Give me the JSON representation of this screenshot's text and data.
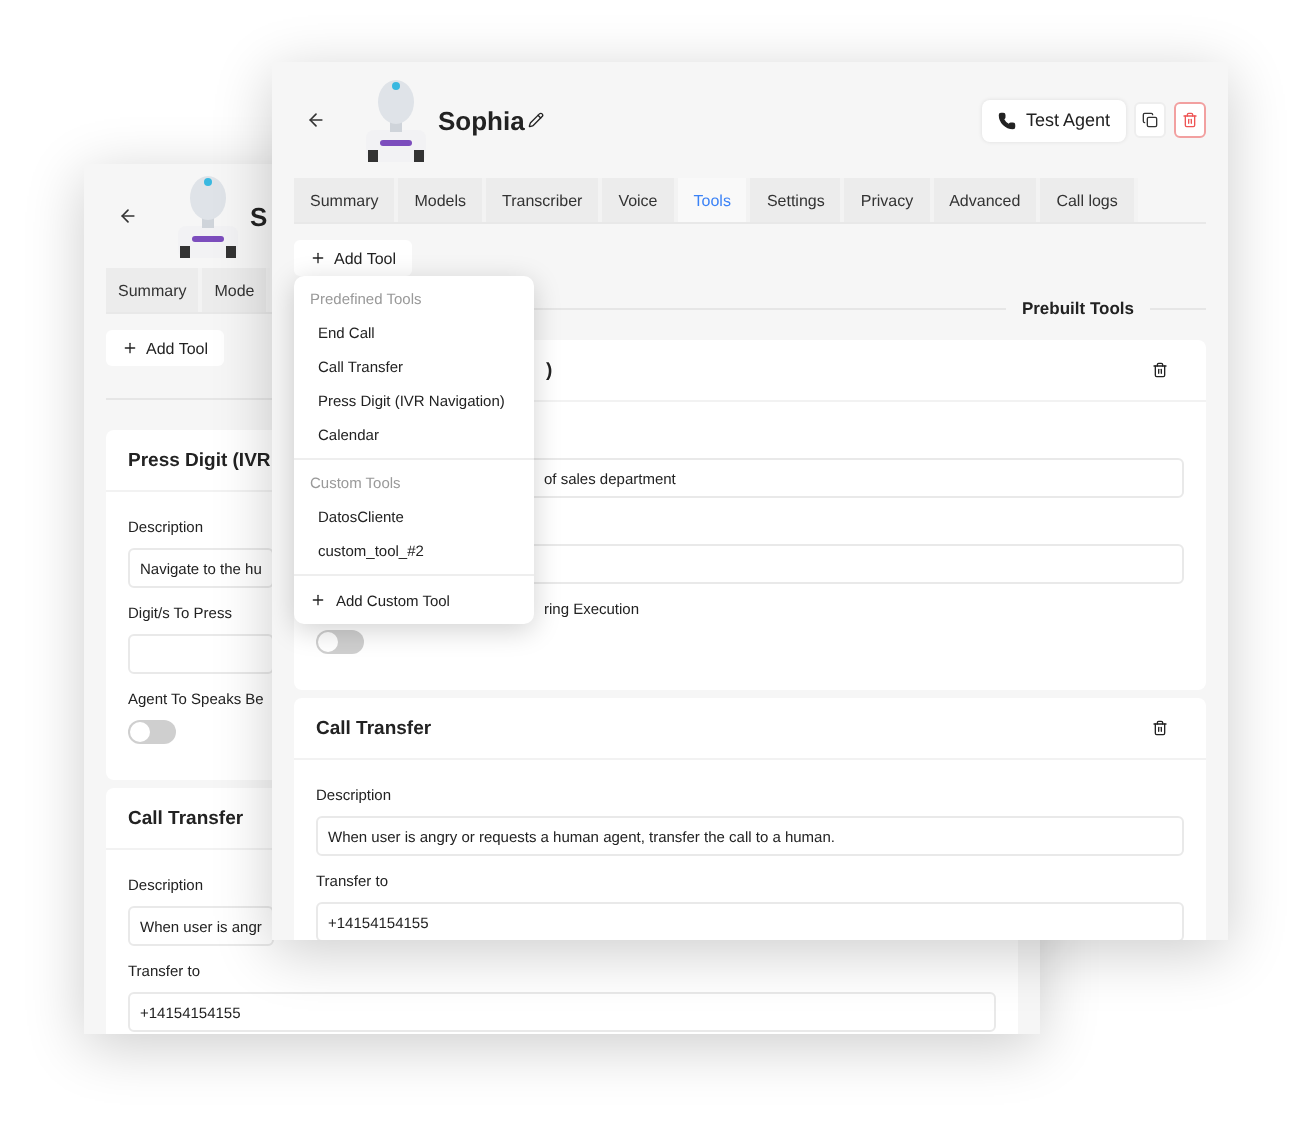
{
  "back_window": {
    "agent_name": "S",
    "name_editable": false,
    "tabs": [
      {
        "label": "Summary",
        "selected": false
      },
      {
        "label": "Mode",
        "selected": false
      }
    ],
    "add_tool_button": "Add Tool",
    "tool_cards": [
      {
        "title": "Press Digit (IVR",
        "fields": [
          {
            "kind": "input",
            "label": "Description",
            "value": "Navigate to the hu"
          },
          {
            "kind": "input",
            "label": "Digit/s To Press"
          },
          {
            "kind": "toggle",
            "label": "Agent To Speaks Be",
            "on": false
          }
        ]
      },
      {
        "title": "Call Transfer",
        "fields": [
          {
            "kind": "input",
            "label": "Description",
            "value": "When user is angr"
          },
          {
            "kind": "input",
            "label": "Transfer to",
            "value": "+14154154155"
          }
        ]
      }
    ]
  },
  "front_window": {
    "agent_name": "Sophia",
    "name_editable": true,
    "test_button": "Test Agent",
    "tabs": [
      {
        "label": "Summary",
        "selected": false
      },
      {
        "label": "Models",
        "selected": false
      },
      {
        "label": "Transcriber",
        "selected": false
      },
      {
        "label": "Voice",
        "selected": false
      },
      {
        "label": "Tools",
        "selected": true
      },
      {
        "label": "Settings",
        "selected": false
      },
      {
        "label": "Privacy",
        "selected": false
      },
      {
        "label": "Advanced",
        "selected": false
      },
      {
        "label": "Call logs",
        "selected": false
      }
    ],
    "add_tool_button": "Add Tool",
    "section_label": "Prebuilt Tools",
    "add_tool_menu": {
      "sections": [
        {
          "header": "Predefined Tools",
          "items": [
            "End Call",
            "Call Transfer",
            "Press Digit (IVR Navigation)",
            "Calendar"
          ]
        },
        {
          "header": "Custom Tools",
          "items": [
            "DatosCliente",
            "custom_tool_#2"
          ]
        }
      ],
      "footer": "Add Custom Tool"
    },
    "tool_cards": [
      {
        "title": ")",
        "deletable": true,
        "fields": [
          {
            "kind": "input",
            "value": "of sales department"
          },
          {
            "kind": "input"
          },
          {
            "kind": "toggle",
            "label": "ring Execution",
            "on": false
          }
        ]
      },
      {
        "title": "Call Transfer",
        "deletable": true,
        "fields": [
          {
            "kind": "input",
            "label": "Description",
            "value": "When user is angry or requests a human agent, transfer the call to a human."
          },
          {
            "kind": "input",
            "label": "Transfer to",
            "value": "+14154154155"
          }
        ]
      }
    ]
  }
}
